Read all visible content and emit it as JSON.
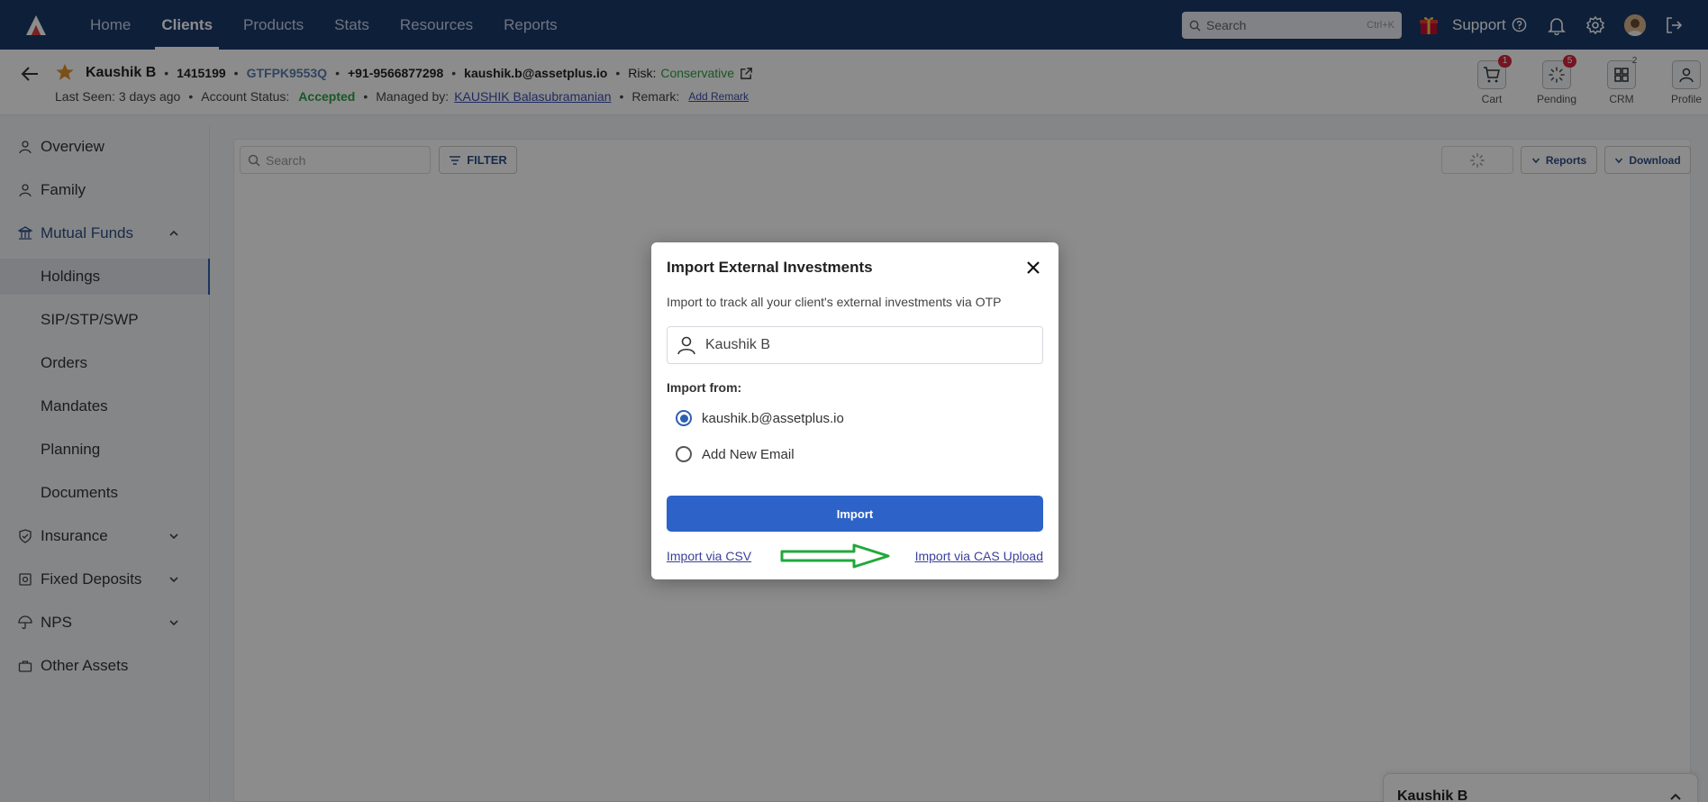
{
  "topnav": {
    "links": [
      {
        "label": "Home"
      },
      {
        "label": "Clients"
      },
      {
        "label": "Products"
      },
      {
        "label": "Stats"
      },
      {
        "label": "Resources"
      },
      {
        "label": "Reports"
      }
    ],
    "active": "Clients",
    "search_placeholder": "Search",
    "search_shortcut": "Ctrl+K",
    "support_label": "Support"
  },
  "client": {
    "name": "Kaushik B",
    "id": "1415199",
    "pan": "GTFPK9553Q",
    "phone": "+91-9566877298",
    "email": "kaushik.b@assetplus.io",
    "risk_label": "Risk:",
    "risk_value": "Conservative",
    "last_seen": "Last Seen: 3 days ago",
    "account_status_label": "Account Status:",
    "account_status": "Accepted",
    "managed_by_label": "Managed by:",
    "managed_by": "KAUSHIK Balasubramanian",
    "remark_label": "Remark:",
    "add_remark": "Add Remark"
  },
  "header_actions": [
    {
      "label": "Cart",
      "badge": "1"
    },
    {
      "label": "Pending",
      "badge": "5"
    },
    {
      "label": "CRM",
      "badge": "2"
    },
    {
      "label": "Profile",
      "badge": ""
    }
  ],
  "sidebar": {
    "items": [
      {
        "label": "Overview",
        "icon": "person-icon"
      },
      {
        "label": "Family",
        "icon": "person-icon"
      },
      {
        "label": "Mutual Funds",
        "icon": "bank-icon"
      },
      {
        "label": "Holdings"
      },
      {
        "label": "SIP/STP/SWP"
      },
      {
        "label": "Orders"
      },
      {
        "label": "Mandates"
      },
      {
        "label": "Planning"
      },
      {
        "label": "Documents"
      },
      {
        "label": "Insurance",
        "icon": "shield-icon"
      },
      {
        "label": "Fixed Deposits",
        "icon": "deposit-icon"
      },
      {
        "label": "NPS",
        "icon": "umbrella-icon"
      },
      {
        "label": "Other Assets",
        "icon": "briefcase-icon"
      }
    ],
    "selected": "Holdings"
  },
  "toolbar": {
    "search_placeholder": "Search",
    "filter_label": "FILTER",
    "reports_label": "Reports",
    "download_label": "Download"
  },
  "modal": {
    "title": "Import External Investments",
    "subtitle": "Import to track all your client's external investments via OTP",
    "client_name": "Kaushik B",
    "import_from_label": "Import from:",
    "options": [
      {
        "label": "kaushik.b@assetplus.io",
        "checked": true
      },
      {
        "label": "Add New Email",
        "checked": false
      }
    ],
    "import_button": "Import",
    "link_csv": "Import via CSV",
    "link_cas": "Import via CAS Upload"
  },
  "chat": {
    "name": "Kaushik B"
  },
  "colors": {
    "nav_bg": "#1b3a6b",
    "primary": "#2d63c8",
    "success": "#2f9e44",
    "annotation_arrow": "#22a83a"
  }
}
